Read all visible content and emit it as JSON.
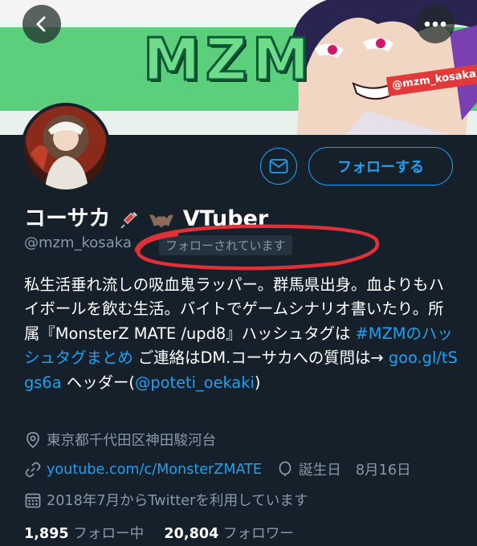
{
  "banner": {
    "logo_text": "MZM",
    "tag_text": "@mzm_kosaka"
  },
  "icons": {
    "back": "chevron-left-icon",
    "more": "more-horizontal-icon",
    "message": "envelope-icon",
    "location": "location-pin-icon",
    "link": "link-icon",
    "birthday": "balloon-icon",
    "joined": "calendar-icon"
  },
  "colors": {
    "background": "#15202b",
    "accent": "#1da1f2",
    "secondary_text": "#8899a6",
    "annotation": "#e03038"
  },
  "profile": {
    "display_name": "コーサカ",
    "name_suffix": "VTuber",
    "handle": "@mzm_kosaka",
    "follows_you_badge": "フォローされています",
    "follow_button": "フォローする"
  },
  "bio": {
    "part1": "私生活垂れ流しの吸血鬼ラッパー。群馬県出身。血よりもハイボールを飲む生活。バイトでゲームシナリオ書いたり。所属『MonsterZ MATE /upd8』ハッシュタグは ",
    "hashtag_link": "#MZMのハッシュタグまとめ",
    "part2": " ご連絡はDM.コーサカへの質問は→ ",
    "url_link": "goo.gl/tSgs6a",
    "part3": " ヘッダー(",
    "mention_link": "@poteti_oekaki",
    "part4": ")"
  },
  "meta": {
    "location": "東京都千代田区神田駿河台",
    "website": "youtube.com/c/MonsterZMATE",
    "birthday_label": "誕生日",
    "birthday_value": "8月16日",
    "joined": "2018年7月からTwitterを利用しています"
  },
  "stats": {
    "following_count": "1,895",
    "following_label": "フォロー中",
    "followers_count": "20,804",
    "followers_label": "フォロワー"
  }
}
